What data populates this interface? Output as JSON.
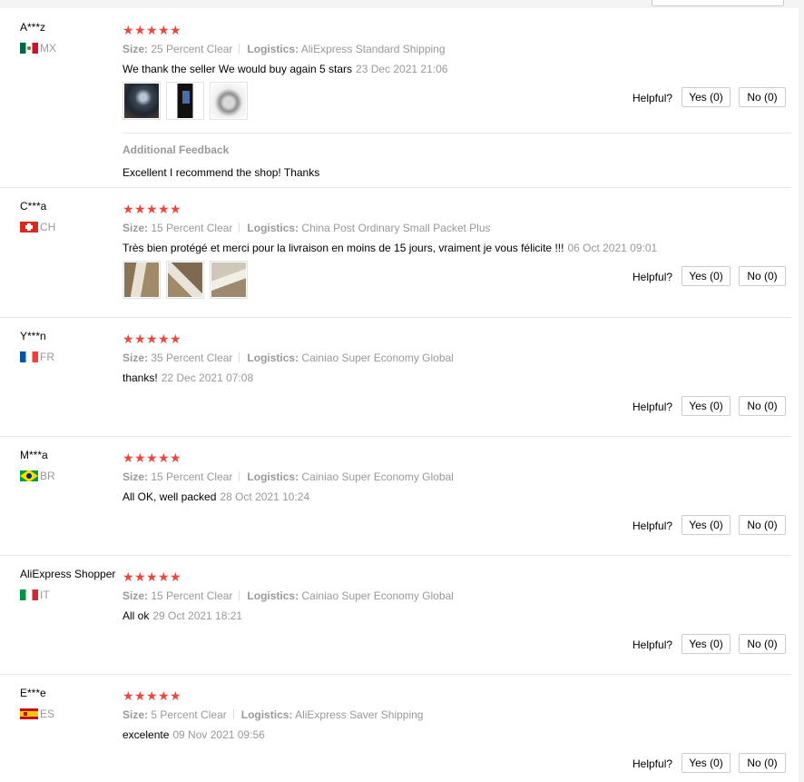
{
  "labels": {
    "size": "Size:",
    "logistics": "Logistics:",
    "helpful": "Helpful?",
    "additional_feedback": "Additional Feedback"
  },
  "colors": {
    "star": "#f0453c",
    "muted": "#999999",
    "border": "#e6e6e6"
  },
  "reviews": [
    {
      "user": "A***z",
      "country": "MX",
      "stars": 5,
      "size": "25 Percent Clear",
      "logistics": "AliExpress Standard Shipping",
      "text": "We thank the seller We would buy again 5 stars",
      "date": "23 Dec 2021 21:06",
      "yes": "Yes (0)",
      "no": "No (0)",
      "additional": "Excellent I recommend the shop! Thanks"
    },
    {
      "user": "C***a",
      "country": "CH",
      "stars": 5,
      "size": "15 Percent Clear",
      "logistics": "China Post Ordinary Small Packet Plus",
      "text": "Très bien protégé et merci pour la livraison en moins de 15 jours, vraiment je vous félicite !!!",
      "date": "06 Oct 2021 09:01",
      "yes": "Yes (0)",
      "no": "No (0)"
    },
    {
      "user": "Y***n",
      "country": "FR",
      "stars": 5,
      "size": "35 Percent Clear",
      "logistics": "Cainiao Super Economy Global",
      "text": "thanks!",
      "date": "22 Dec 2021 07:08",
      "yes": "Yes (0)",
      "no": "No (0)"
    },
    {
      "user": "M***a",
      "country": "BR",
      "stars": 5,
      "size": "15 Percent Clear",
      "logistics": "Cainiao Super Economy Global",
      "text": "All OK, well packed",
      "date": "28 Oct 2021 10:24",
      "yes": "Yes (0)",
      "no": "No (0)"
    },
    {
      "user": "AliExpress Shopper",
      "country": "IT",
      "stars": 5,
      "size": "15 Percent Clear",
      "logistics": "Cainiao Super Economy Global",
      "text": "All ok",
      "date": "29 Oct 2021 18:21",
      "yes": "Yes (0)",
      "no": "No (0)"
    },
    {
      "user": "E***e",
      "country": "ES",
      "stars": 5,
      "size": "5 Percent Clear",
      "logistics": "AliExpress Saver Shipping",
      "text": "excelente",
      "date": "09 Nov 2021 09:56",
      "yes": "Yes (0)",
      "no": "No (0)"
    }
  ]
}
